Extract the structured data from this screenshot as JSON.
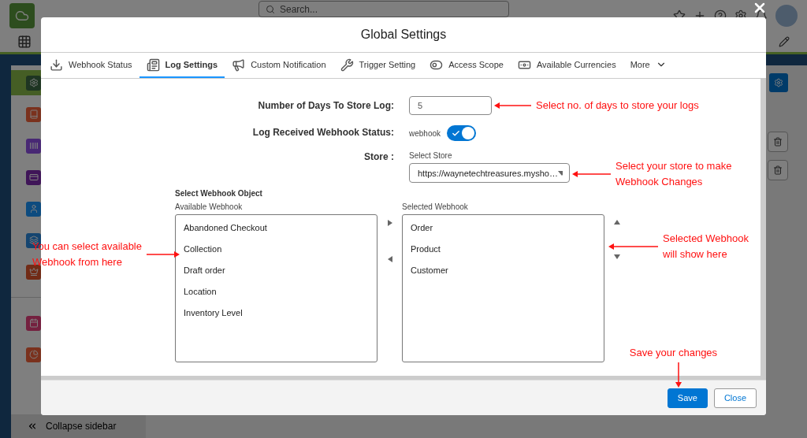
{
  "app": {
    "search": {
      "placeholder": "Search..."
    },
    "sidebar": {
      "items": [
        {
          "selected": true
        },
        {
          "selected": false
        },
        {
          "selected": false
        },
        {
          "selected": false
        },
        {
          "selected": false
        },
        {
          "selected": false
        },
        {
          "selected": false
        },
        {
          "selected": false
        },
        {
          "selected": false
        }
      ],
      "collapse_label": "Collapse sidebar"
    }
  },
  "dialog": {
    "title": "Global Settings",
    "tabs": [
      {
        "label": "Webhook Status",
        "selected": false
      },
      {
        "label": "Log Settings",
        "selected": true
      },
      {
        "label": "Custom Notification",
        "selected": false
      },
      {
        "label": "Trigger Setting",
        "selected": false
      },
      {
        "label": "Access Scope",
        "selected": false
      },
      {
        "label": "Available Currencies",
        "selected": false
      }
    ],
    "more_label": "More",
    "form": {
      "days": {
        "label": "Number of Days To Store Log:",
        "value": "5",
        "annotation": [
          "Select no. of days to store your logs"
        ]
      },
      "log_status": {
        "label": "Log Received Webhook Status:",
        "toggle_label": "webhook",
        "on": true
      },
      "store": {
        "label": "Store :",
        "field_label": "Select Store",
        "value": "https://waynetechtreasures.mysho…",
        "annotation": [
          "Select your store to make",
          "Webhook Changes"
        ]
      }
    },
    "webhook_picker": {
      "title": "Select Webhook Object",
      "available": {
        "label": "Available Webhook",
        "items": [
          "Abandoned Checkout",
          "Collection",
          "Draft order",
          "Location",
          "Inventory Level"
        ],
        "annotation": [
          "You can select available",
          "Webhook from here"
        ]
      },
      "selected": {
        "label": "Selected Webhook",
        "items": [
          "Order",
          "Product",
          "Customer"
        ],
        "annotation": [
          "Selected Webhook",
          "will show here"
        ]
      }
    },
    "buttons": [
      {
        "label": "Save",
        "kind": "primary",
        "annotation": [
          "Save your changes"
        ]
      },
      {
        "label": "Close",
        "kind": "secondary"
      }
    ]
  }
}
